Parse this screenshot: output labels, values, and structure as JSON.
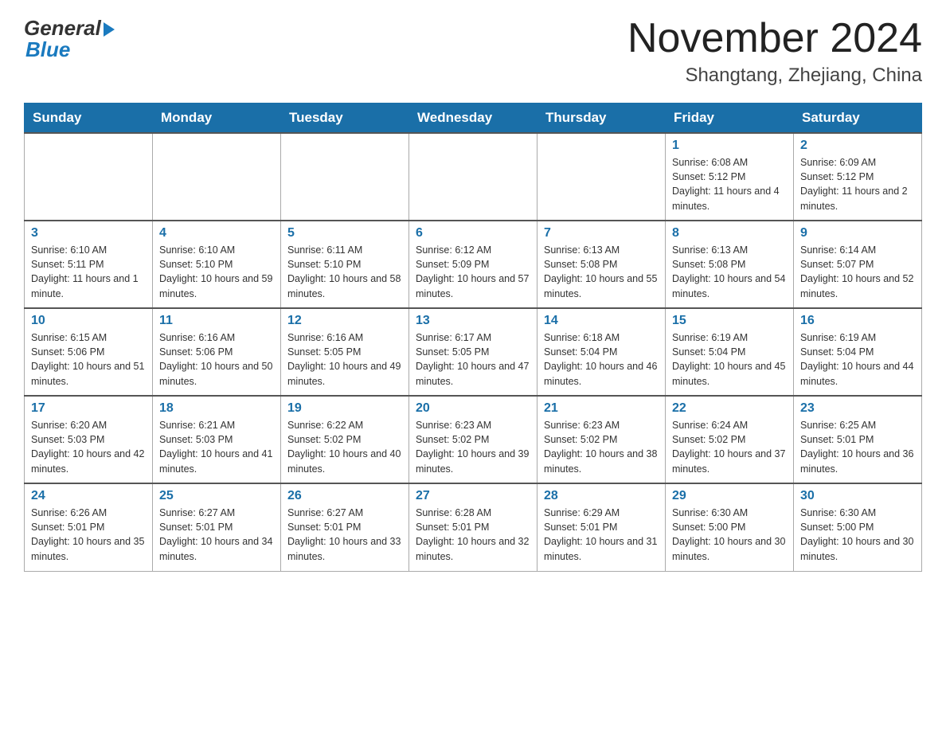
{
  "header": {
    "logo_general": "General",
    "logo_blue": "Blue",
    "month_year": "November 2024",
    "location": "Shangtang, Zhejiang, China"
  },
  "weekdays": [
    "Sunday",
    "Monday",
    "Tuesday",
    "Wednesday",
    "Thursday",
    "Friday",
    "Saturday"
  ],
  "weeks": [
    [
      {
        "day": "",
        "info": ""
      },
      {
        "day": "",
        "info": ""
      },
      {
        "day": "",
        "info": ""
      },
      {
        "day": "",
        "info": ""
      },
      {
        "day": "",
        "info": ""
      },
      {
        "day": "1",
        "info": "Sunrise: 6:08 AM\nSunset: 5:12 PM\nDaylight: 11 hours and 4 minutes."
      },
      {
        "day": "2",
        "info": "Sunrise: 6:09 AM\nSunset: 5:12 PM\nDaylight: 11 hours and 2 minutes."
      }
    ],
    [
      {
        "day": "3",
        "info": "Sunrise: 6:10 AM\nSunset: 5:11 PM\nDaylight: 11 hours and 1 minute."
      },
      {
        "day": "4",
        "info": "Sunrise: 6:10 AM\nSunset: 5:10 PM\nDaylight: 10 hours and 59 minutes."
      },
      {
        "day": "5",
        "info": "Sunrise: 6:11 AM\nSunset: 5:10 PM\nDaylight: 10 hours and 58 minutes."
      },
      {
        "day": "6",
        "info": "Sunrise: 6:12 AM\nSunset: 5:09 PM\nDaylight: 10 hours and 57 minutes."
      },
      {
        "day": "7",
        "info": "Sunrise: 6:13 AM\nSunset: 5:08 PM\nDaylight: 10 hours and 55 minutes."
      },
      {
        "day": "8",
        "info": "Sunrise: 6:13 AM\nSunset: 5:08 PM\nDaylight: 10 hours and 54 minutes."
      },
      {
        "day": "9",
        "info": "Sunrise: 6:14 AM\nSunset: 5:07 PM\nDaylight: 10 hours and 52 minutes."
      }
    ],
    [
      {
        "day": "10",
        "info": "Sunrise: 6:15 AM\nSunset: 5:06 PM\nDaylight: 10 hours and 51 minutes."
      },
      {
        "day": "11",
        "info": "Sunrise: 6:16 AM\nSunset: 5:06 PM\nDaylight: 10 hours and 50 minutes."
      },
      {
        "day": "12",
        "info": "Sunrise: 6:16 AM\nSunset: 5:05 PM\nDaylight: 10 hours and 49 minutes."
      },
      {
        "day": "13",
        "info": "Sunrise: 6:17 AM\nSunset: 5:05 PM\nDaylight: 10 hours and 47 minutes."
      },
      {
        "day": "14",
        "info": "Sunrise: 6:18 AM\nSunset: 5:04 PM\nDaylight: 10 hours and 46 minutes."
      },
      {
        "day": "15",
        "info": "Sunrise: 6:19 AM\nSunset: 5:04 PM\nDaylight: 10 hours and 45 minutes."
      },
      {
        "day": "16",
        "info": "Sunrise: 6:19 AM\nSunset: 5:04 PM\nDaylight: 10 hours and 44 minutes."
      }
    ],
    [
      {
        "day": "17",
        "info": "Sunrise: 6:20 AM\nSunset: 5:03 PM\nDaylight: 10 hours and 42 minutes."
      },
      {
        "day": "18",
        "info": "Sunrise: 6:21 AM\nSunset: 5:03 PM\nDaylight: 10 hours and 41 minutes."
      },
      {
        "day": "19",
        "info": "Sunrise: 6:22 AM\nSunset: 5:02 PM\nDaylight: 10 hours and 40 minutes."
      },
      {
        "day": "20",
        "info": "Sunrise: 6:23 AM\nSunset: 5:02 PM\nDaylight: 10 hours and 39 minutes."
      },
      {
        "day": "21",
        "info": "Sunrise: 6:23 AM\nSunset: 5:02 PM\nDaylight: 10 hours and 38 minutes."
      },
      {
        "day": "22",
        "info": "Sunrise: 6:24 AM\nSunset: 5:02 PM\nDaylight: 10 hours and 37 minutes."
      },
      {
        "day": "23",
        "info": "Sunrise: 6:25 AM\nSunset: 5:01 PM\nDaylight: 10 hours and 36 minutes."
      }
    ],
    [
      {
        "day": "24",
        "info": "Sunrise: 6:26 AM\nSunset: 5:01 PM\nDaylight: 10 hours and 35 minutes."
      },
      {
        "day": "25",
        "info": "Sunrise: 6:27 AM\nSunset: 5:01 PM\nDaylight: 10 hours and 34 minutes."
      },
      {
        "day": "26",
        "info": "Sunrise: 6:27 AM\nSunset: 5:01 PM\nDaylight: 10 hours and 33 minutes."
      },
      {
        "day": "27",
        "info": "Sunrise: 6:28 AM\nSunset: 5:01 PM\nDaylight: 10 hours and 32 minutes."
      },
      {
        "day": "28",
        "info": "Sunrise: 6:29 AM\nSunset: 5:01 PM\nDaylight: 10 hours and 31 minutes."
      },
      {
        "day": "29",
        "info": "Sunrise: 6:30 AM\nSunset: 5:00 PM\nDaylight: 10 hours and 30 minutes."
      },
      {
        "day": "30",
        "info": "Sunrise: 6:30 AM\nSunset: 5:00 PM\nDaylight: 10 hours and 30 minutes."
      }
    ]
  ]
}
